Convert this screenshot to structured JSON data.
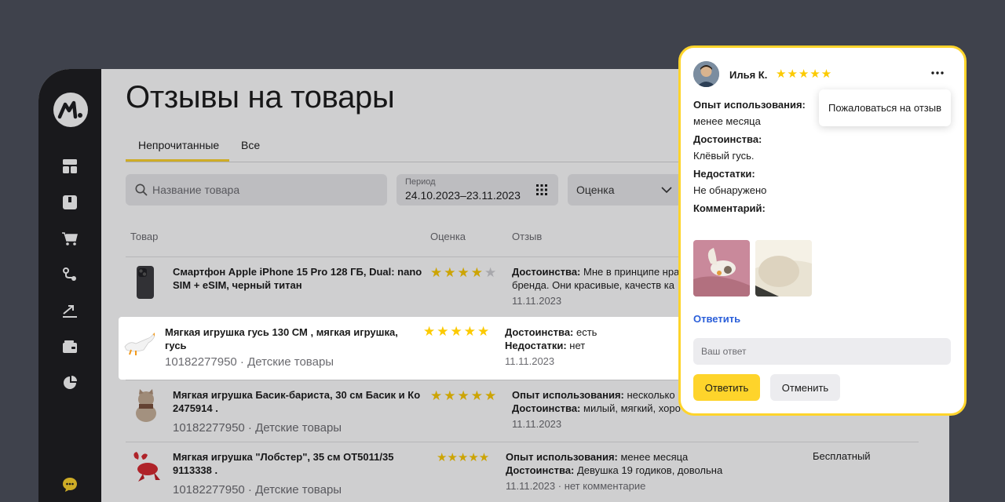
{
  "page": {
    "title": "Отзывы на товары"
  },
  "tabs": [
    {
      "label": "Непрочитанные"
    },
    {
      "label": "Все"
    }
  ],
  "filters": {
    "search_placeholder": "Название товара",
    "period_label": "Период",
    "period_value": "24.10.2023–23.11.2023",
    "rating_label": "Оценка"
  },
  "columns": {
    "product": "Товар",
    "rating": "Оценка",
    "review": "Отзыв"
  },
  "sidebar": {
    "icons": [
      "dashboard-icon",
      "box-icon",
      "cart-icon",
      "route-icon",
      "growth-icon",
      "wallet-icon",
      "pie-chart-icon"
    ]
  },
  "rows": [
    {
      "name": "Смартфон Apple iPhone 15 Pro 128 ГБ, Dual: nano SIM + eSIM, черный титан",
      "rating": 4,
      "review_label": "Достоинства:",
      "review_text": " Мне в принципе нра",
      "review_line2": "бренда. Они красивые, качеств ка",
      "date": "11.11.2023"
    },
    {
      "name": "Мягкая игрушка гусь 130 СМ , мягкая игрушка, гусь",
      "meta": "10182277950 · Детские товары",
      "rating": 5,
      "adv_label": "Достоинства:",
      "adv_text": " есть",
      "dis_label": "Недостатки:",
      "dis_text": " нет",
      "date": "11.11.2023"
    },
    {
      "name": "Мягкая игрушка Басик-бариста, 30 см Басик и Ко 2475914 .",
      "meta": "10182277950 · Детские товары",
      "rating": 5,
      "exp_label": "Опыт использования:",
      "exp_text": " несколько м",
      "adv_label": "Достоинства:",
      "adv_text": " милый, мягкий, хоро",
      "date": "11.11.2023"
    },
    {
      "name": "Мягкая игрушка \"Лобстер\", 35 см OT5011/35 9113338 .",
      "meta": "10182277950 · Детские товары",
      "rating": 5,
      "exp_label": "Опыт использования:",
      "exp_text": " менее месяца",
      "adv_label": "Достоинства:",
      "adv_text": " Девушка 19 годиков, довольна",
      "date": "11.11.2023",
      "comment": "нет комментарие",
      "extra": "Бесплатный"
    }
  ],
  "review_card": {
    "user": "Илья К.",
    "rating": 5,
    "menu_item": "Пожаловаться на отзыв",
    "exp_label": "Опыт использования:",
    "exp_value": "менее месяца",
    "adv_label": "Достоинства:",
    "adv_value": "Клёвый гусь.",
    "dis_label": "Недостатки:",
    "dis_value": "Не обнаружено",
    "comment_label": "Комментарий:",
    "reply_link": "Ответить",
    "answer_placeholder": "Ваш ответ",
    "submit": "Ответить",
    "cancel": "Отменить"
  },
  "colors": {
    "accent": "#fed42b",
    "star": "#fcca00",
    "link": "#2b5fd9",
    "sidebar": "#1c1c1e",
    "backdrop": "#3f424c"
  }
}
